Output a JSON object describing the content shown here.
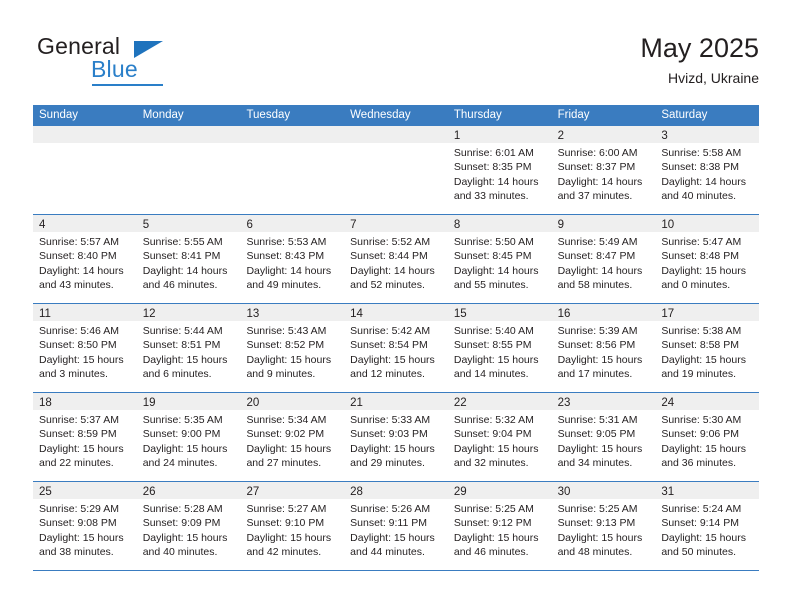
{
  "brand": {
    "name_top": "General",
    "name_bottom": "Blue",
    "accent_color": "#2a7fc9",
    "logo_icon": "triangle-flag-icon"
  },
  "header": {
    "title": "May 2025",
    "location": "Hvizd, Ukraine"
  },
  "calendar": {
    "header_bg": "#3a7cc0",
    "header_text_color": "#ffffff",
    "daynum_strip_bg": "#efefef",
    "weekday_names": [
      "Sunday",
      "Monday",
      "Tuesday",
      "Wednesday",
      "Thursday",
      "Friday",
      "Saturday"
    ],
    "weeks": [
      [
        {
          "day": "",
          "lines": []
        },
        {
          "day": "",
          "lines": []
        },
        {
          "day": "",
          "lines": []
        },
        {
          "day": "",
          "lines": []
        },
        {
          "day": "1",
          "lines": [
            "Sunrise: 6:01 AM",
            "Sunset: 8:35 PM",
            "Daylight: 14 hours",
            "and 33 minutes."
          ]
        },
        {
          "day": "2",
          "lines": [
            "Sunrise: 6:00 AM",
            "Sunset: 8:37 PM",
            "Daylight: 14 hours",
            "and 37 minutes."
          ]
        },
        {
          "day": "3",
          "lines": [
            "Sunrise: 5:58 AM",
            "Sunset: 8:38 PM",
            "Daylight: 14 hours",
            "and 40 minutes."
          ]
        }
      ],
      [
        {
          "day": "4",
          "lines": [
            "Sunrise: 5:57 AM",
            "Sunset: 8:40 PM",
            "Daylight: 14 hours",
            "and 43 minutes."
          ]
        },
        {
          "day": "5",
          "lines": [
            "Sunrise: 5:55 AM",
            "Sunset: 8:41 PM",
            "Daylight: 14 hours",
            "and 46 minutes."
          ]
        },
        {
          "day": "6",
          "lines": [
            "Sunrise: 5:53 AM",
            "Sunset: 8:43 PM",
            "Daylight: 14 hours",
            "and 49 minutes."
          ]
        },
        {
          "day": "7",
          "lines": [
            "Sunrise: 5:52 AM",
            "Sunset: 8:44 PM",
            "Daylight: 14 hours",
            "and 52 minutes."
          ]
        },
        {
          "day": "8",
          "lines": [
            "Sunrise: 5:50 AM",
            "Sunset: 8:45 PM",
            "Daylight: 14 hours",
            "and 55 minutes."
          ]
        },
        {
          "day": "9",
          "lines": [
            "Sunrise: 5:49 AM",
            "Sunset: 8:47 PM",
            "Daylight: 14 hours",
            "and 58 minutes."
          ]
        },
        {
          "day": "10",
          "lines": [
            "Sunrise: 5:47 AM",
            "Sunset: 8:48 PM",
            "Daylight: 15 hours",
            "and 0 minutes."
          ]
        }
      ],
      [
        {
          "day": "11",
          "lines": [
            "Sunrise: 5:46 AM",
            "Sunset: 8:50 PM",
            "Daylight: 15 hours",
            "and 3 minutes."
          ]
        },
        {
          "day": "12",
          "lines": [
            "Sunrise: 5:44 AM",
            "Sunset: 8:51 PM",
            "Daylight: 15 hours",
            "and 6 minutes."
          ]
        },
        {
          "day": "13",
          "lines": [
            "Sunrise: 5:43 AM",
            "Sunset: 8:52 PM",
            "Daylight: 15 hours",
            "and 9 minutes."
          ]
        },
        {
          "day": "14",
          "lines": [
            "Sunrise: 5:42 AM",
            "Sunset: 8:54 PM",
            "Daylight: 15 hours",
            "and 12 minutes."
          ]
        },
        {
          "day": "15",
          "lines": [
            "Sunrise: 5:40 AM",
            "Sunset: 8:55 PM",
            "Daylight: 15 hours",
            "and 14 minutes."
          ]
        },
        {
          "day": "16",
          "lines": [
            "Sunrise: 5:39 AM",
            "Sunset: 8:56 PM",
            "Daylight: 15 hours",
            "and 17 minutes."
          ]
        },
        {
          "day": "17",
          "lines": [
            "Sunrise: 5:38 AM",
            "Sunset: 8:58 PM",
            "Daylight: 15 hours",
            "and 19 minutes."
          ]
        }
      ],
      [
        {
          "day": "18",
          "lines": [
            "Sunrise: 5:37 AM",
            "Sunset: 8:59 PM",
            "Daylight: 15 hours",
            "and 22 minutes."
          ]
        },
        {
          "day": "19",
          "lines": [
            "Sunrise: 5:35 AM",
            "Sunset: 9:00 PM",
            "Daylight: 15 hours",
            "and 24 minutes."
          ]
        },
        {
          "day": "20",
          "lines": [
            "Sunrise: 5:34 AM",
            "Sunset: 9:02 PM",
            "Daylight: 15 hours",
            "and 27 minutes."
          ]
        },
        {
          "day": "21",
          "lines": [
            "Sunrise: 5:33 AM",
            "Sunset: 9:03 PM",
            "Daylight: 15 hours",
            "and 29 minutes."
          ]
        },
        {
          "day": "22",
          "lines": [
            "Sunrise: 5:32 AM",
            "Sunset: 9:04 PM",
            "Daylight: 15 hours",
            "and 32 minutes."
          ]
        },
        {
          "day": "23",
          "lines": [
            "Sunrise: 5:31 AM",
            "Sunset: 9:05 PM",
            "Daylight: 15 hours",
            "and 34 minutes."
          ]
        },
        {
          "day": "24",
          "lines": [
            "Sunrise: 5:30 AM",
            "Sunset: 9:06 PM",
            "Daylight: 15 hours",
            "and 36 minutes."
          ]
        }
      ],
      [
        {
          "day": "25",
          "lines": [
            "Sunrise: 5:29 AM",
            "Sunset: 9:08 PM",
            "Daylight: 15 hours",
            "and 38 minutes."
          ]
        },
        {
          "day": "26",
          "lines": [
            "Sunrise: 5:28 AM",
            "Sunset: 9:09 PM",
            "Daylight: 15 hours",
            "and 40 minutes."
          ]
        },
        {
          "day": "27",
          "lines": [
            "Sunrise: 5:27 AM",
            "Sunset: 9:10 PM",
            "Daylight: 15 hours",
            "and 42 minutes."
          ]
        },
        {
          "day": "28",
          "lines": [
            "Sunrise: 5:26 AM",
            "Sunset: 9:11 PM",
            "Daylight: 15 hours",
            "and 44 minutes."
          ]
        },
        {
          "day": "29",
          "lines": [
            "Sunrise: 5:25 AM",
            "Sunset: 9:12 PM",
            "Daylight: 15 hours",
            "and 46 minutes."
          ]
        },
        {
          "day": "30",
          "lines": [
            "Sunrise: 5:25 AM",
            "Sunset: 9:13 PM",
            "Daylight: 15 hours",
            "and 48 minutes."
          ]
        },
        {
          "day": "31",
          "lines": [
            "Sunrise: 5:24 AM",
            "Sunset: 9:14 PM",
            "Daylight: 15 hours",
            "and 50 minutes."
          ]
        }
      ]
    ]
  }
}
